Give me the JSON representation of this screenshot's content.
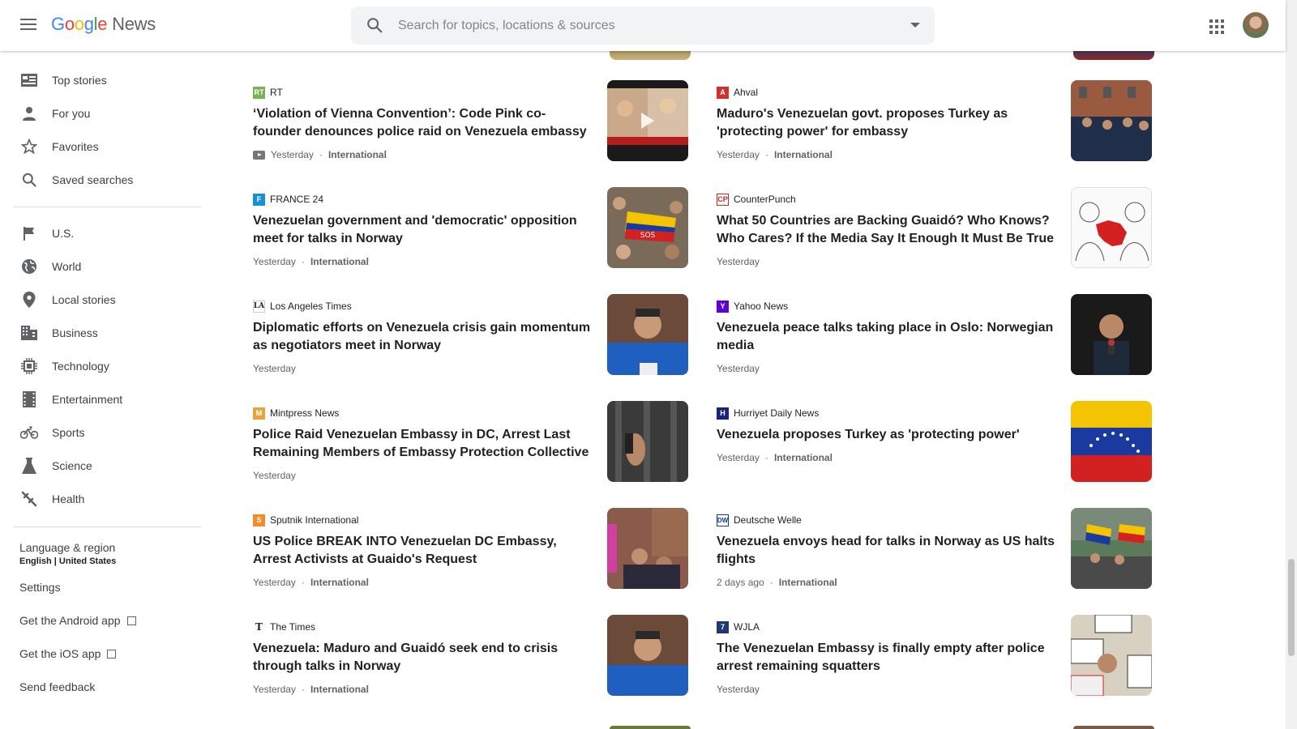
{
  "header": {
    "logo_google": "Google",
    "logo_news": "News",
    "search_placeholder": "Search for topics, locations & sources"
  },
  "sidebar": {
    "primary": [
      {
        "label": "Top stories",
        "icon": "top-stories-icon"
      },
      {
        "label": "For you",
        "icon": "person-icon"
      },
      {
        "label": "Favorites",
        "icon": "star-icon"
      },
      {
        "label": "Saved searches",
        "icon": "search-icon"
      }
    ],
    "sections": [
      {
        "label": "U.S.",
        "icon": "flag-icon"
      },
      {
        "label": "World",
        "icon": "globe-icon"
      },
      {
        "label": "Local stories",
        "icon": "pin-icon"
      },
      {
        "label": "Business",
        "icon": "building-icon"
      },
      {
        "label": "Technology",
        "icon": "chip-icon"
      },
      {
        "label": "Entertainment",
        "icon": "film-icon"
      },
      {
        "label": "Sports",
        "icon": "bike-icon"
      },
      {
        "label": "Science",
        "icon": "flask-icon"
      },
      {
        "label": "Health",
        "icon": "health-icon"
      }
    ],
    "language_label": "Language & region",
    "language_value": "English | United States",
    "settings": "Settings",
    "android_app": "Get the Android app",
    "ios_app": "Get the iOS app",
    "feedback": "Send feedback"
  },
  "articles": {
    "left": [
      {
        "source": "RT",
        "fav_color": "#77b255",
        "title": "‘Violation of Vienna Convention’: Code Pink co-founder denounces police raid on Venezuela embassy",
        "time": "Yesterday",
        "category": "International",
        "video": true
      },
      {
        "source": "FRANCE 24",
        "fav_color": "#1a8fd6",
        "title": "Venezuelan government and 'democratic' opposition meet for talks in Norway",
        "time": "Yesterday",
        "category": "International"
      },
      {
        "source": "Los Angeles Times",
        "fav_color": "#555555",
        "title": "Diplomatic efforts on Venezuela crisis gain momentum as negotiators meet in Norway",
        "time": "Yesterday",
        "category": ""
      },
      {
        "source": "Mintpress News",
        "fav_color": "#e8a33b",
        "title": "Police Raid Venezuelan Embassy in DC, Arrest Last Remaining Members of Embassy Protection Collective",
        "time": "Yesterday",
        "category": ""
      },
      {
        "source": "Sputnik International",
        "fav_color": "#f28c28",
        "title": "US Police BREAK INTO Venezuelan DC Embassy, Arrest Activists at Guaido's Request",
        "time": "Yesterday",
        "category": "International"
      },
      {
        "source": "The Times",
        "fav_color": "#222222",
        "title": "Venezuela: Maduro and Guaidó seek end to crisis through talks in Norway",
        "time": "Yesterday",
        "category": "International"
      }
    ],
    "right": [
      {
        "source": "Ahval",
        "fav_color": "#d32f2f",
        "title": "Maduro's Venezuelan govt. proposes Turkey as 'protecting power' for embassy",
        "time": "Yesterday",
        "category": "International"
      },
      {
        "source": "CounterPunch",
        "fav_color": "#c62828",
        "title": "What 50 Countries are Backing Guaidó? Who Knows? Who Cares? If the Media Say It Enough It Must Be True",
        "time": "Yesterday",
        "category": ""
      },
      {
        "source": "Yahoo News",
        "fav_color": "#5f01d1",
        "title": "Venezuela peace talks taking place in Oslo: Norwegian media",
        "time": "Yesterday",
        "category": ""
      },
      {
        "source": "Hurriyet Daily News",
        "fav_color": "#1a237e",
        "title": "Venezuela proposes Turkey as 'protecting power'",
        "time": "Yesterday",
        "category": "International"
      },
      {
        "source": "Deutsche Welle",
        "fav_color": "#0a3d91",
        "title": "Venezuela envoys head for talks in Norway as US halts flights",
        "time": "2 days ago",
        "category": "International"
      },
      {
        "source": "WJLA",
        "fav_color": "#1f3a6e",
        "title": "The Venezuelan Embassy is finally empty after police arrest remaining squatters",
        "time": "Yesterday",
        "category": ""
      }
    ]
  }
}
